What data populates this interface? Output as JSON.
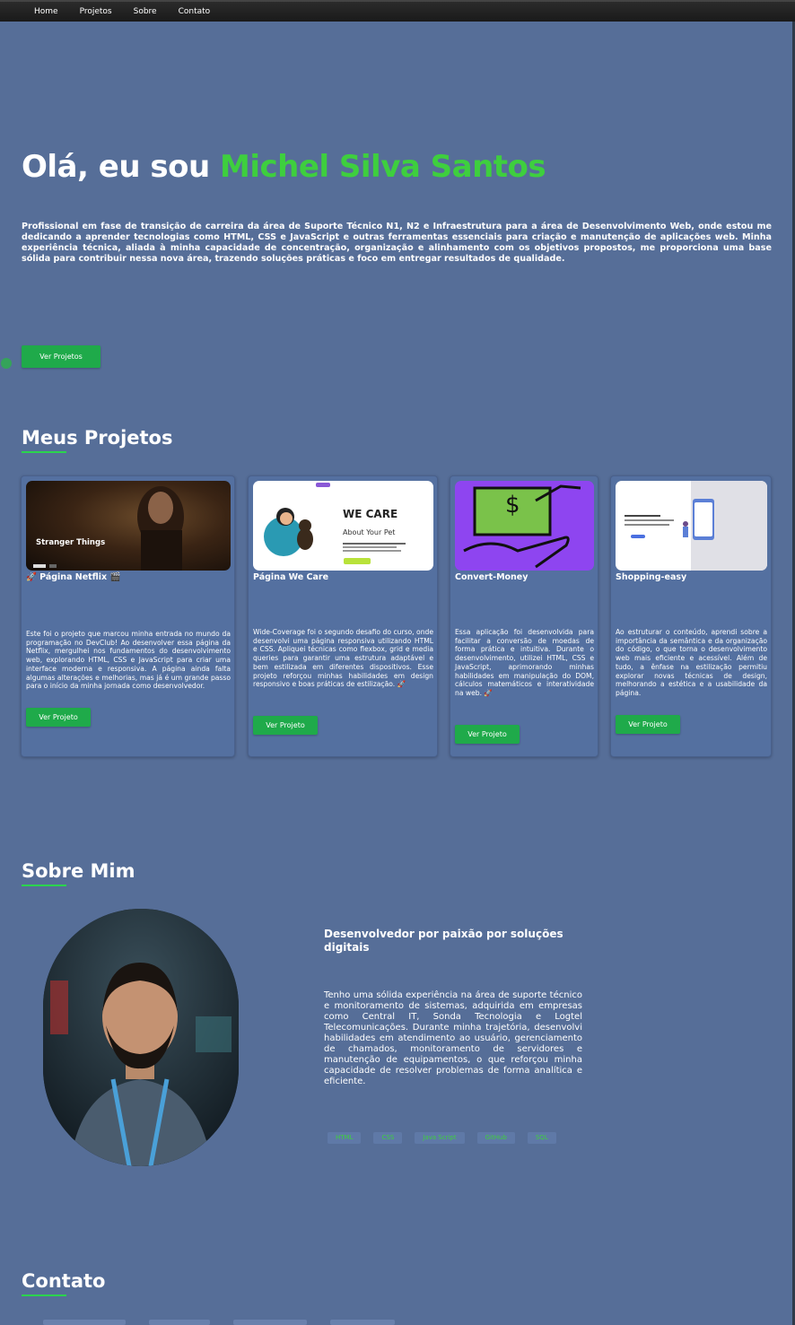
{
  "nav": {
    "items": [
      "Home",
      "Projetos",
      "Sobre",
      "Contato"
    ]
  },
  "hero": {
    "title_prefix": "Olá, eu sou ",
    "title_name": "Michel Silva Santos",
    "accent_color": "#3ecf3e",
    "description": "Profissional em fase de transição de carreira da área de Suporte Técnico N1, N2 e Infraestrutura para a área de Desenvolvimento Web, onde estou me dedicando a aprender tecnologias como HTML, CSS e JavaScript e outras ferramentas essenciais para criação e manutenção de aplicações web. Minha experiência técnica, aliada à minha capacidade de concentração, organização e alinhamento com os objetivos propostos, me proporciona uma base sólida para contribuir nessa nova área, trazendo soluções práticas e foco em entregar resultados de qualidade.",
    "button": "Ver Projetos"
  },
  "projects": {
    "title": "Meus Projetos",
    "items": [
      {
        "title": "🚀 Página Netflix 🎬",
        "thumb_text": "Stranger Things",
        "description": "Este foi o projeto que marcou minha entrada no mundo da programação no DevClub! Ao desenvolver essa página da Netflix, mergulhei nos fundamentos do desenvolvimento web, explorando HTML, CSS e JavaScript para criar uma interface moderna e responsiva. A página ainda falta algumas alterações e melhorias, mas já é um grande passo para o início da minha jornada como desenvolvedor.",
        "button": "Ver Projeto"
      },
      {
        "title": "Página We Care",
        "thumb_text": "WE CARE",
        "thumb_subtext": "About Your Pet",
        "description": "Wide-Coverage foi o segundo desafio do curso, onde desenvolvi uma página responsiva utilizando HTML e CSS. Apliquei técnicas como flexbox, grid e media queries para garantir uma estrutura adaptável e bem estilizada em diferentes dispositivos. Esse projeto reforçou minhas habilidades em design responsivo e boas práticas de estilização. 🚀",
        "button": "Ver Projeto"
      },
      {
        "title": "Convert-Money",
        "thumb_text": "$",
        "description": "Essa aplicação foi desenvolvida para facilitar a conversão de moedas de forma prática e intuitiva. Durante o desenvolvimento, utilizei HTML, CSS e JavaScript, aprimorando minhas habilidades em manipulação do DOM, cálculos matemáticos e interatividade na web. 🚀",
        "button": "Ver Projeto"
      },
      {
        "title": "Shopping-easy",
        "description": "Ao estruturar o conteúdo, aprendi sobre a importância da semântica e da organização do código, o que torna o desenvolvimento web mais eficiente e acessível. Além de tudo, a ênfase na estilização permitiu explorar novas técnicas de design, melhorando a estética e a usabilidade da página.",
        "button": "Ver Projeto"
      }
    ]
  },
  "about": {
    "title": "Sobre Mim",
    "heading": "Desenvolvedor por paixão por soluções digitais",
    "text": "Tenho uma sólida experiência na área de suporte técnico e monitoramento de sistemas, adquirida em empresas como Central IT, Sonda Tecnologia e Logtel Telecomunicações. Durante minha trajetória, desenvolvi habilidades em atendimento ao usuário, gerenciamento de chamados, monitoramento de servidores e manutenção de equipamentos, o que reforçou minha capacidade de resolver problemas de forma analítica e eficiente.",
    "skills": [
      "HTML",
      "CSS",
      "Java Script",
      "GitHub",
      "SQL"
    ]
  },
  "contact": {
    "title": "Contato"
  }
}
